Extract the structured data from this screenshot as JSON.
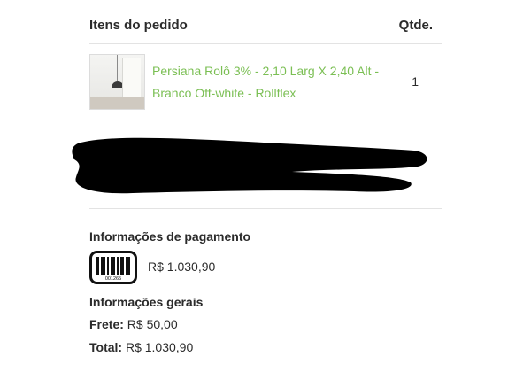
{
  "order_items": {
    "header_title": "Itens do pedido",
    "header_qty": "Qtde.",
    "items": [
      {
        "name": "Persiana Rolô 3% - 2,10 Larg X 2,40 Alt - Branco Off-white - Rollflex",
        "qty": "1"
      }
    ]
  },
  "payment": {
    "title": "Informações de pagamento",
    "method_icon": "boleto-barcode-icon",
    "method_icon_code": "001265",
    "amount": "R$ 1.030,90"
  },
  "general": {
    "title": "Informações gerais",
    "shipping_label": "Frete:",
    "shipping_value": "R$ 50,00",
    "total_label": "Total:",
    "total_value": "R$ 1.030,90"
  },
  "colors": {
    "product_link": "#7bbf54",
    "text": "#2b2b2b",
    "divider": "#e3e3e3",
    "redaction": "#000000"
  }
}
